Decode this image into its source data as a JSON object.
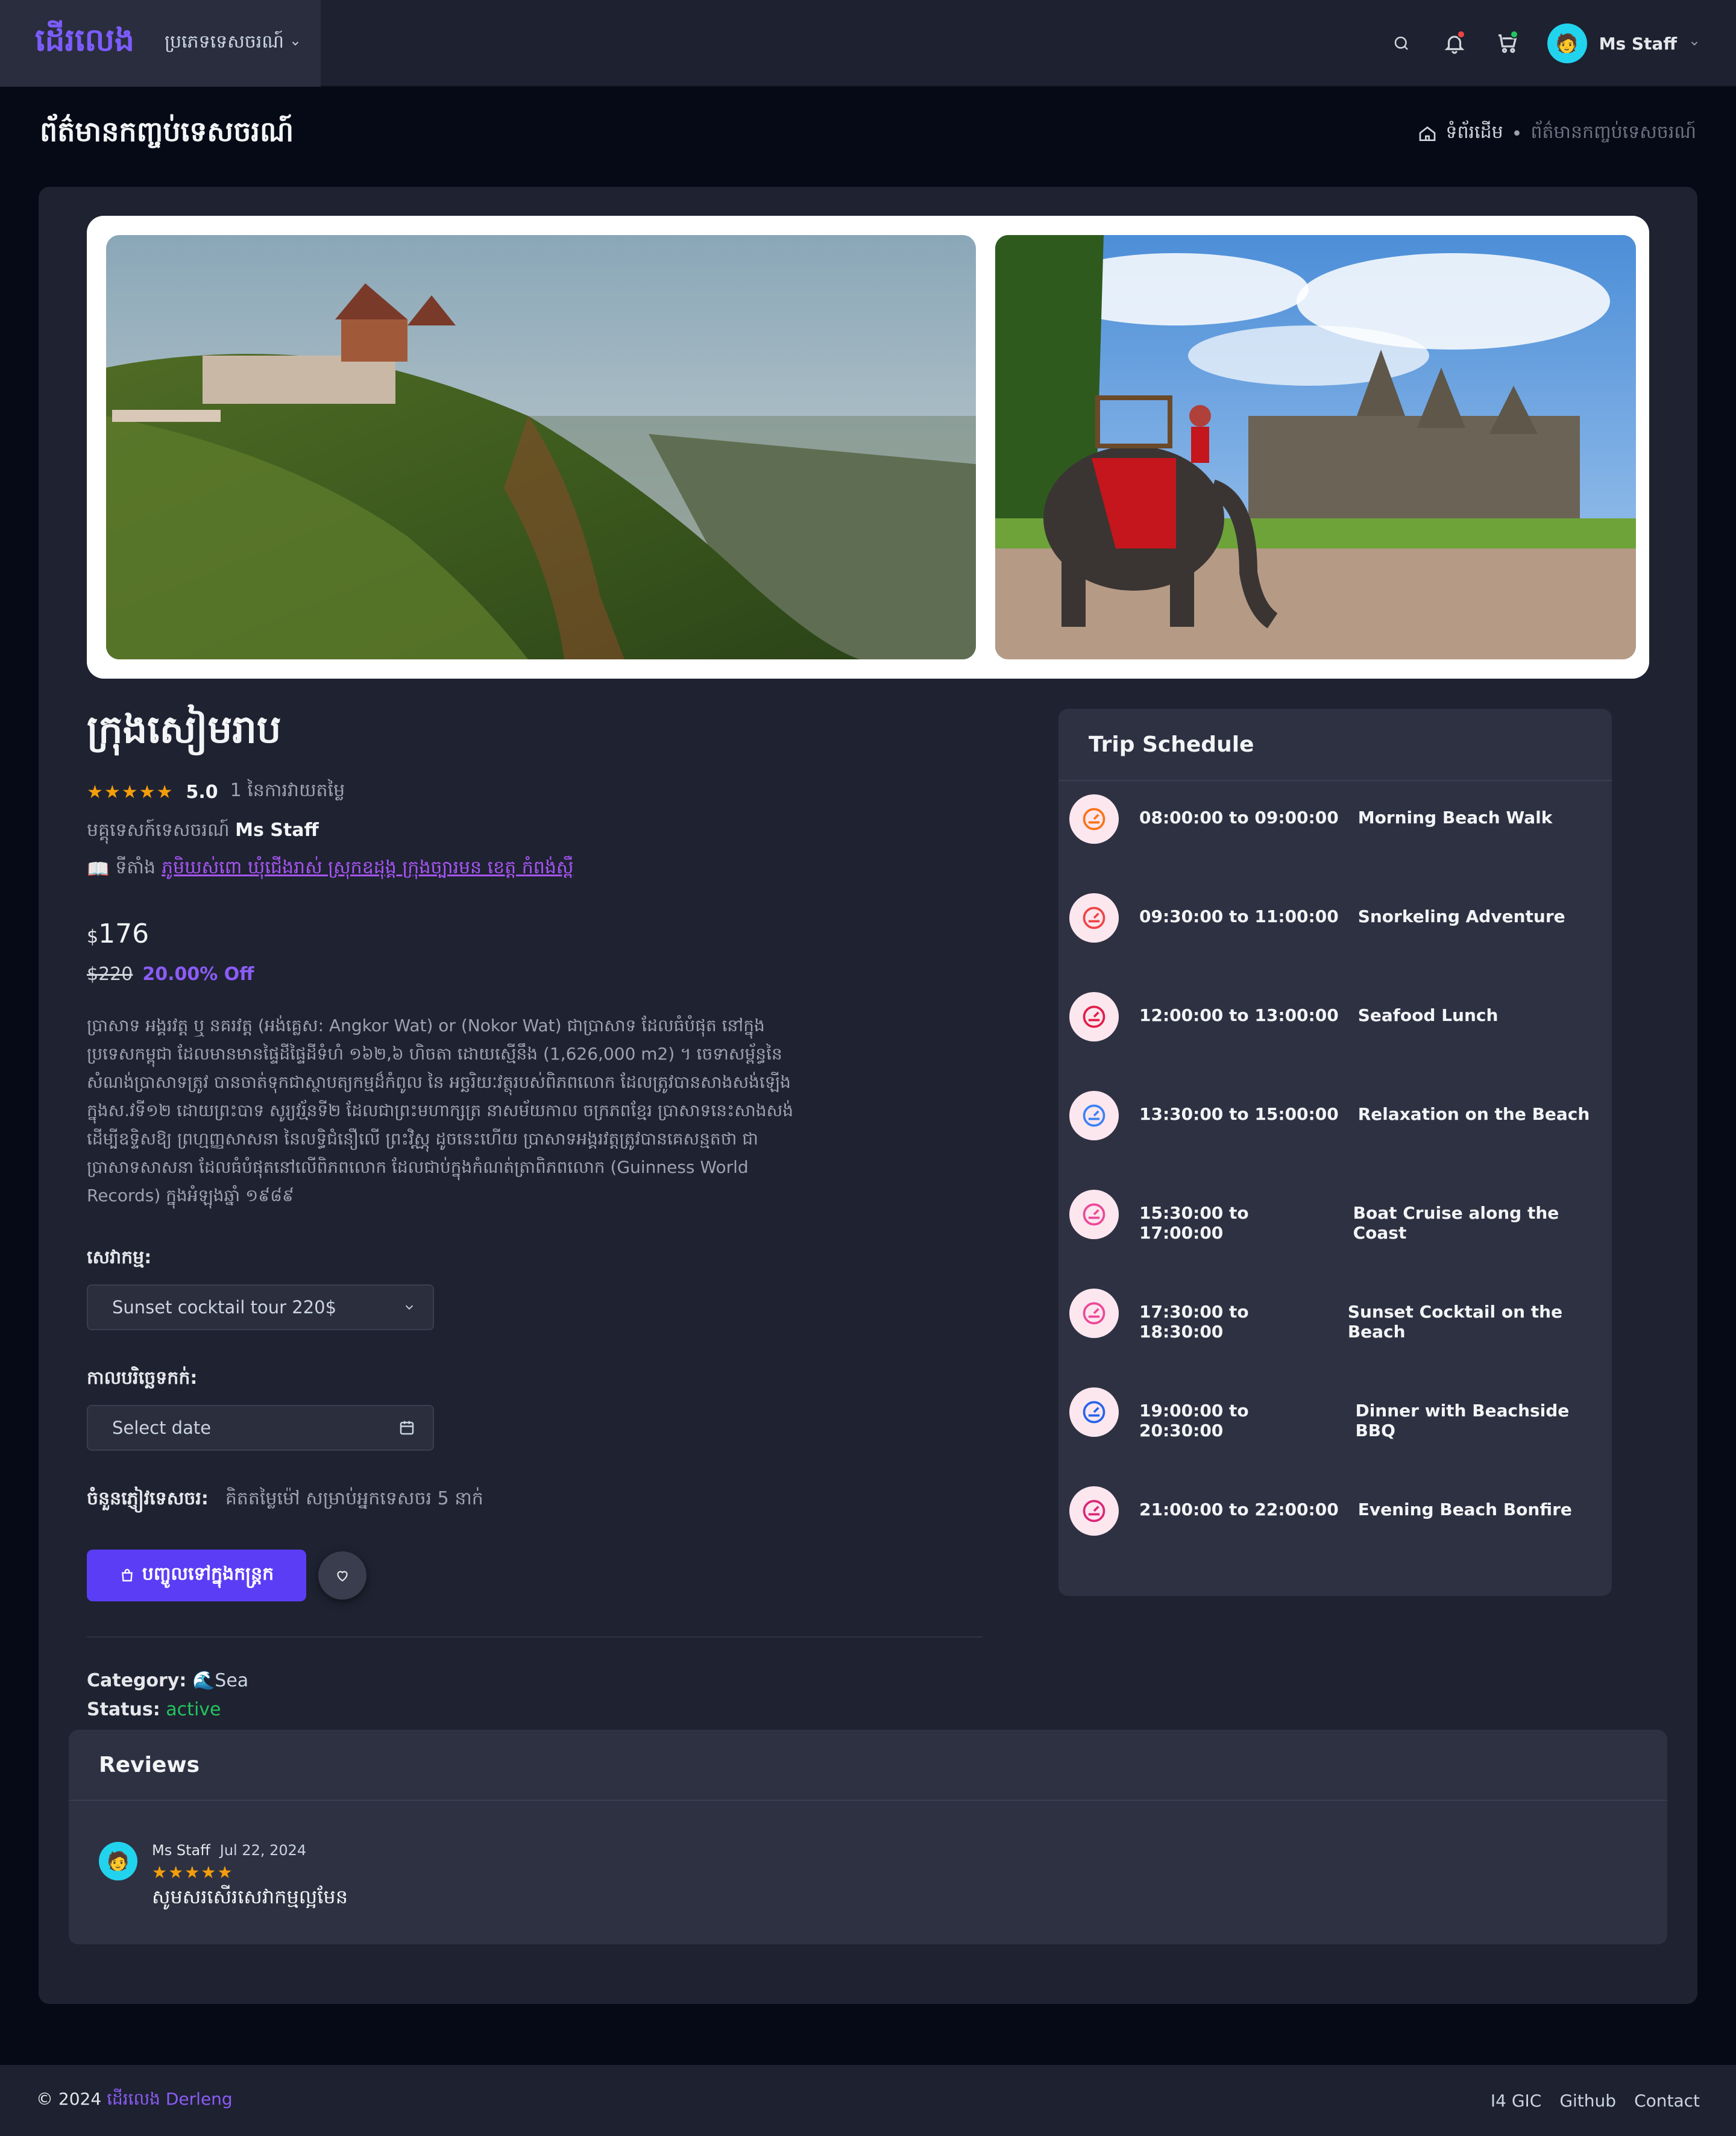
{
  "header": {
    "brand": "ដើរលេង",
    "menu_label": "ប្រភេទទេសចរណ៍",
    "user_name": "Ms Staff",
    "icons": [
      "search-icon",
      "bell-icon",
      "cart-icon",
      "chevron-down-icon"
    ],
    "notification_dot_color": "#ef4444",
    "cart_dot_color": "#22c55e"
  },
  "page": {
    "title": "ព័ត៌មានកញ្ចប់ទេសចរណ៍",
    "breadcrumb": {
      "home": "ទំព័រដើម",
      "separator": "•",
      "current": "ព័ត៌មានកញ្ចប់ទេសចរណ៍"
    }
  },
  "tour": {
    "name": "ក្រុងសៀមរាប",
    "stars": "★★★★★",
    "rating": "5.0",
    "rating_count": "1 នៃការវាយតម្លៃ",
    "guide_label": "មគ្គុទេសក៍ទេសចរណ៍",
    "guide_name": "Ms Staff",
    "location_icon": "📖",
    "location_label": "ទីតាំង",
    "location_value": "ភូមិឃស់ពោ ឃុំជើងរាស់ ស្រុកឧដុង្គ ក្រុងច្បារមន ខេត្ត កំពង់ស្ពឺ",
    "currency": "$",
    "price": "176",
    "old_price": "$220",
    "discount": "20.00% Off",
    "description": "ប្រាសាទ អង្គរវត្ត ឬ នគរវត្ត (អង់គ្លេស: Angkor Wat) or (Nokor Wat) ជាប្រាសាទ ដែលធំបំផុត នៅក្នុងប្រទេសកម្ពុជា ដែលមានមានផ្ទៃដីផ្ទៃដីទំហំ ១៦២,៦ ហិចតា ដោយស្មើនឹង (1,626,000 m2) ។ ចេទាសម្ព័ន្ធនៃសំណង់ប្រាសាទត្រូវ បានចាត់ទុកជាស្ថាបត្យកម្មដ៏កំពូល នៃ អច្ឆរិយៈវត្ថុរបស់ពិភពលោក ដែលត្រូវបានសាងសង់ឡើងក្នុងស.វទី១២ ដោយព្រះបាទ សូរ្យវរ្ម័នទី២ ដែលជាព្រះមហាក្សត្រ នាសម័យកាល ចក្រភពខ្មែរ ប្រាសាទនេះសាងសង់ ដើម្បីឧទ្ទិសឱ្យ ព្រហ្មញ្ញសាសនា នៃលទ្ធិជំនឿលើ ព្រះវិស្ណុ ដូចនេះហើយ ប្រាសាទអង្គរវត្តត្រូវបានគេសន្មតថា ជាប្រាសាទសាសនា ដែលធំបំផុតនៅលើពិភពលោក ដែលជាប់ក្នុងកំណត់ត្រាពិភពលោក (Guinness World Records) ក្នុងអំឡុងឆ្នាំ ១៩៨៩",
    "service_label": "សេវាកម្ម:",
    "service_value": "Sunset cocktail tour 220$",
    "date_label": "កាលបរិច្ឆេទកក់:",
    "date_placeholder": "Select date",
    "guests_label": "ចំនួនភ្ញៀវទេសចរ:",
    "guests_note": "គិតតម្លៃម៉ៅ សម្រាប់អ្នកទេសចរ 5 នាក់",
    "cart_button": "បញ្ចូលទៅក្នុងកន្ត្រក",
    "category_label": "Category:",
    "category_icon": "🌊",
    "category_value": "Sea",
    "status_label": "Status:",
    "status_value": "active"
  },
  "schedule": {
    "title": "Trip Schedule",
    "items": [
      {
        "time": "08:00:00 to 09:00:00",
        "activity": "Morning Beach Walk",
        "color": "#f97316"
      },
      {
        "time": "09:30:00 to 11:00:00",
        "activity": "Snorkeling Adventure",
        "color": "#ef4444"
      },
      {
        "time": "12:00:00 to 13:00:00",
        "activity": "Seafood Lunch",
        "color": "#e11d48"
      },
      {
        "time": "13:30:00 to 15:00:00",
        "activity": "Relaxation on the Beach",
        "color": "#3b82f6"
      },
      {
        "time": "15:30:00 to 17:00:00",
        "activity": "Boat Cruise along the Coast",
        "color": "#ec4899"
      },
      {
        "time": "17:30:00 to 18:30:00",
        "activity": "Sunset Cocktail on the Beach",
        "color": "#ec4899"
      },
      {
        "time": "19:00:00 to 20:30:00",
        "activity": "Dinner with Beachside BBQ",
        "color": "#2563eb"
      },
      {
        "time": "21:00:00 to 22:00:00",
        "activity": "Evening Beach Bonfire",
        "color": "#db2777"
      }
    ]
  },
  "reviews": {
    "title": "Reviews",
    "items": [
      {
        "author": "Ms Staff",
        "date": "Jul 22, 2024",
        "stars": "★★★★★",
        "text": "សូមសរសើរសេវាកម្មល្អមែន"
      }
    ]
  },
  "footer": {
    "copyright": "© 2024",
    "brand_kh": "ដើរលេង",
    "brand_en": "Derleng",
    "links": [
      "I4 GIC",
      "Github",
      "Contact"
    ]
  }
}
